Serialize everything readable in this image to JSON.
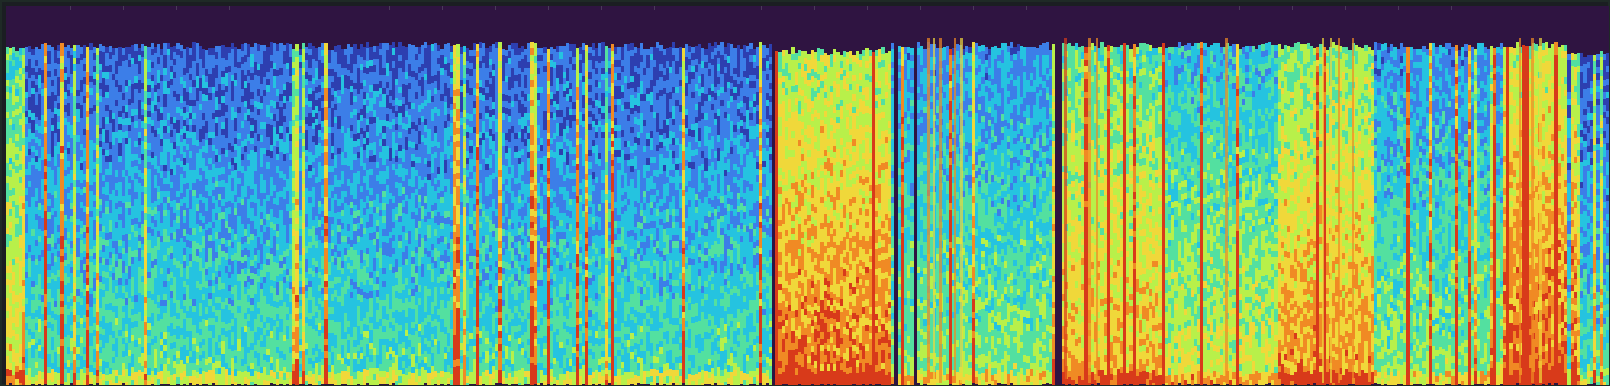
{
  "spectrogram": {
    "colors": {
      "background": "#2f1441",
      "frame": "#1f2a26"
    },
    "colormap": [
      "#2b135e",
      "#2d3fb0",
      "#3c7ee8",
      "#25c3e0",
      "#53e0a0",
      "#b8f04a",
      "#f0d83a",
      "#f08a24",
      "#d83a1a"
    ]
  }
}
